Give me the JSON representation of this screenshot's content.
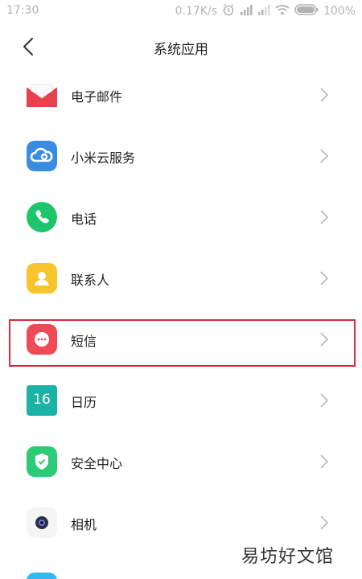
{
  "status_bar": {
    "time": "17:30",
    "net_speed": "0.17K/s",
    "battery": "100%"
  },
  "header": {
    "title": "系统应用"
  },
  "apps": [
    {
      "label": "电子邮件",
      "icon": "email-icon"
    },
    {
      "label": "小米云服务",
      "icon": "cloud-icon"
    },
    {
      "label": "电话",
      "icon": "phone-icon"
    },
    {
      "label": "联系人",
      "icon": "contacts-icon"
    },
    {
      "label": "短信",
      "icon": "sms-icon"
    },
    {
      "label": "日历",
      "icon": "calendar-icon",
      "badge": "16"
    },
    {
      "label": "安全中心",
      "icon": "shield-icon"
    },
    {
      "label": "相机",
      "icon": "camera-icon"
    }
  ],
  "watermark": "易坊好文馆"
}
